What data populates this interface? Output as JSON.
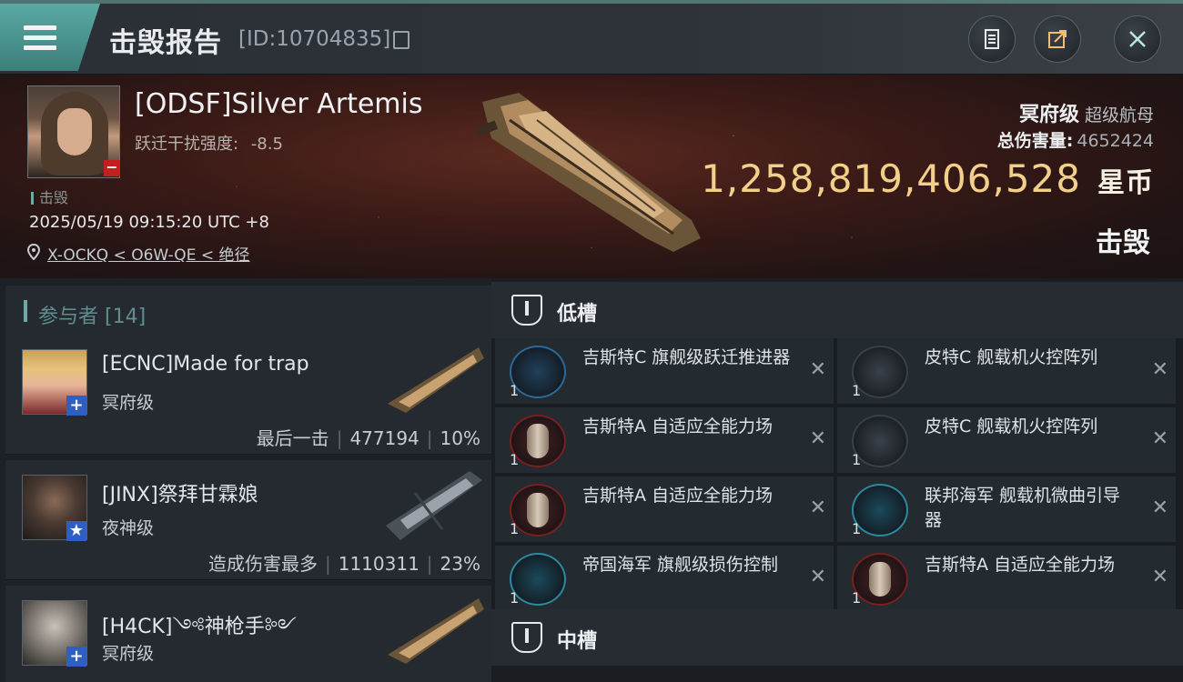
{
  "header": {
    "title": "击毁报告",
    "report_id": "[ID:10704835]",
    "icons": [
      "menu-icon",
      "copy-icon",
      "clipboard-icon",
      "share-icon",
      "close-icon"
    ]
  },
  "victim": {
    "name": "[ODSF]Silver Artemis",
    "warp_jam_label": "跃迁干扰强度:",
    "warp_jam_value": "-8.5",
    "status": "击毁",
    "datetime": "2025/05/19 09:15:20 UTC +8",
    "location": "X-OCKQ < O6W-QE < 绝径",
    "ship_class": "冥府级",
    "ship_type": "超级航母",
    "total_damage_label": "总伤害量:",
    "total_damage_value": "4652424",
    "isk_value": "1,258,819,406,528",
    "isk_unit": "星币",
    "result": "击毁"
  },
  "participants": {
    "header": "参与者 [14]",
    "items": [
      {
        "name": "[ECNC]Made for trap",
        "ship": "冥府级",
        "role": "最后一击",
        "damage": "477194",
        "percent": "10%"
      },
      {
        "name": "[JINX]祭拜甘霖娘",
        "ship": "夜神级",
        "role": "造成伤害最多",
        "damage": "1110311",
        "percent": "23%"
      },
      {
        "name": "[H4CK]༺神枪手༻",
        "ship": "冥府级",
        "role": "",
        "damage": "",
        "percent": ""
      }
    ]
  },
  "slots": {
    "low_label": "低槽",
    "mid_label": "中槽",
    "low_modules": [
      {
        "name": "吉斯特C 旗舰级跃迁推进器",
        "qty": "1"
      },
      {
        "name": "皮特C 舰载机火控阵列",
        "qty": "1"
      },
      {
        "name": "吉斯特A 自适应全能力场",
        "qty": "1"
      },
      {
        "name": "皮特C 舰载机火控阵列",
        "qty": "1"
      },
      {
        "name": "吉斯特A 自适应全能力场",
        "qty": "1"
      },
      {
        "name": "联邦海军 舰载机微曲引导器",
        "qty": "1"
      },
      {
        "name": "帝国海军 旗舰级损伤控制",
        "qty": "1"
      },
      {
        "name": "吉斯特A 自适应全能力场",
        "qty": "1"
      }
    ],
    "remove_glyph": "✕"
  }
}
